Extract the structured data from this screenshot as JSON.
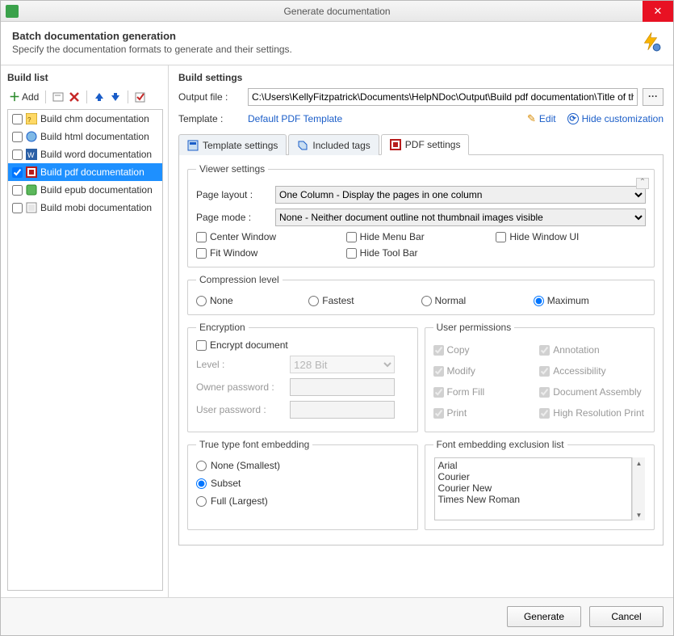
{
  "window_title": "Generate documentation",
  "header": {
    "title": "Batch documentation generation",
    "subtitle": "Specify the documentation formats to generate and their settings."
  },
  "build_list": {
    "title": "Build list",
    "add_label": "Add",
    "items": [
      {
        "label": "Build chm documentation",
        "checked": false,
        "selected": false
      },
      {
        "label": "Build html documentation",
        "checked": false,
        "selected": false
      },
      {
        "label": "Build word documentation",
        "checked": false,
        "selected": false
      },
      {
        "label": "Build pdf documentation",
        "checked": true,
        "selected": true
      },
      {
        "label": "Build epub documentation",
        "checked": false,
        "selected": false
      },
      {
        "label": "Build mobi documentation",
        "checked": false,
        "selected": false
      }
    ]
  },
  "build_settings": {
    "title": "Build settings",
    "output_label": "Output file :",
    "output_value": "C:\\Users\\KellyFitzpatrick\\Documents\\HelpNDoc\\Output\\Build pdf documentation\\Title of this help project.pd",
    "template_label": "Template :",
    "template_value": "Default PDF Template",
    "edit_label": "Edit",
    "hide_label": "Hide customization"
  },
  "tabs": [
    {
      "label": "Template settings",
      "active": false
    },
    {
      "label": "Included tags",
      "active": false
    },
    {
      "label": "PDF settings",
      "active": true
    }
  ],
  "pdf": {
    "viewer_group": "Viewer settings",
    "page_layout_label": "Page layout :",
    "page_layout_value": "One Column - Display the pages in one column",
    "page_mode_label": "Page mode :",
    "page_mode_value": "None - Neither document outline not thumbnail images visible",
    "center_window": "Center Window",
    "hide_menu": "Hide Menu Bar",
    "hide_window_ui": "Hide Window UI",
    "fit_window": "Fit Window",
    "hide_toolbar": "Hide Tool Bar",
    "compression_group": "Compression level",
    "compression": {
      "none": "None",
      "fastest": "Fastest",
      "normal": "Normal",
      "maximum": "Maximum",
      "selected": "maximum"
    },
    "encryption_group": "Encryption",
    "encrypt_doc": "Encrypt document",
    "level_label": "Level :",
    "level_value": "128 Bit",
    "owner_pw": "Owner password :",
    "user_pw": "User password :",
    "permissions_group": "User permissions",
    "perm": {
      "copy": "Copy",
      "modify": "Modify",
      "formfill": "Form Fill",
      "print": "Print",
      "annotation": "Annotation",
      "accessibility": "Accessibility",
      "docassembly": "Document Assembly",
      "highres": "High Resolution Print"
    },
    "ttf_group": "True type font embedding",
    "ttf": {
      "none": "None (Smallest)",
      "subset": "Subset",
      "full": "Full (Largest)",
      "selected": "subset"
    },
    "exclusion_group": "Font embedding exclusion list",
    "fonts": [
      "Arial",
      "Courier",
      "Courier New",
      "Times New Roman"
    ]
  },
  "footer": {
    "generate": "Generate",
    "cancel": "Cancel"
  }
}
